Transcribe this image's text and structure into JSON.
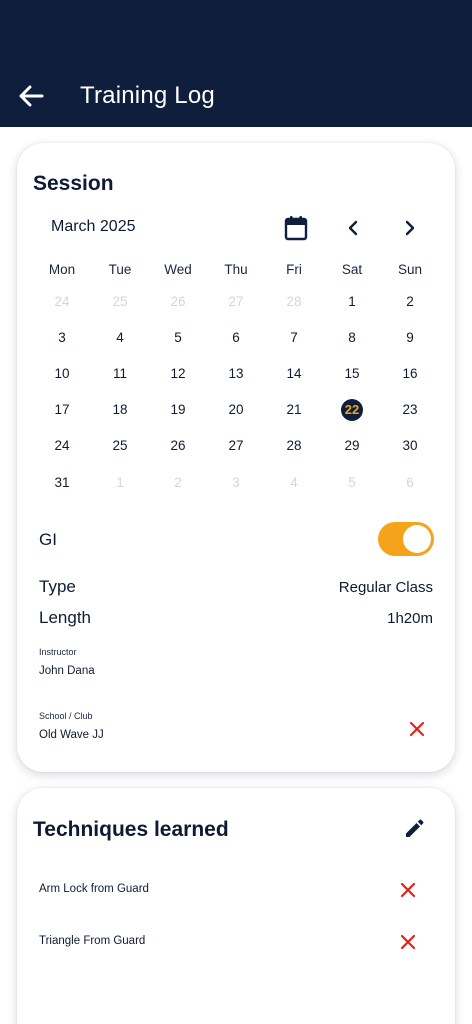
{
  "appbar": {
    "title": "Training Log"
  },
  "session": {
    "title": "Session",
    "calendar": {
      "month": "March 2025",
      "weekdays": [
        "Mon",
        "Tue",
        "Wed",
        "Thu",
        "Fri",
        "Sat",
        "Sun"
      ],
      "days": [
        {
          "d": "24",
          "muted": true
        },
        {
          "d": "25",
          "muted": true
        },
        {
          "d": "26",
          "muted": true
        },
        {
          "d": "27",
          "muted": true
        },
        {
          "d": "28",
          "muted": true
        },
        {
          "d": "1"
        },
        {
          "d": "2"
        },
        {
          "d": "3"
        },
        {
          "d": "4"
        },
        {
          "d": "5"
        },
        {
          "d": "6"
        },
        {
          "d": "7"
        },
        {
          "d": "8"
        },
        {
          "d": "9"
        },
        {
          "d": "10"
        },
        {
          "d": "11"
        },
        {
          "d": "12"
        },
        {
          "d": "13"
        },
        {
          "d": "14"
        },
        {
          "d": "15"
        },
        {
          "d": "16"
        },
        {
          "d": "17"
        },
        {
          "d": "18"
        },
        {
          "d": "19"
        },
        {
          "d": "20"
        },
        {
          "d": "21"
        },
        {
          "d": "22",
          "selected": true
        },
        {
          "d": "23"
        },
        {
          "d": "24"
        },
        {
          "d": "25"
        },
        {
          "d": "26"
        },
        {
          "d": "27"
        },
        {
          "d": "28"
        },
        {
          "d": "29"
        },
        {
          "d": "30"
        },
        {
          "d": "31"
        },
        {
          "d": "1",
          "muted": true
        },
        {
          "d": "2",
          "muted": true
        },
        {
          "d": "3",
          "muted": true
        },
        {
          "d": "4",
          "muted": true
        },
        {
          "d": "5",
          "muted": true
        },
        {
          "d": "6",
          "muted": true
        }
      ]
    },
    "gi": {
      "label": "GI",
      "on": true
    },
    "type": {
      "label": "Type",
      "value": "Regular Class"
    },
    "length": {
      "label": "Length",
      "value": "1h20m"
    },
    "instructor": {
      "label": "Instructor",
      "value": "John Dana"
    },
    "school": {
      "label": "School / Club",
      "value": "Old Wave JJ"
    }
  },
  "techniques": {
    "title": "Techniques learned",
    "items": [
      "Arm Lock from Guard",
      "Triangle From Guard"
    ]
  },
  "colors": {
    "navy": "#0f1e3d",
    "accent": "#f5a31a",
    "danger": "#e0241b"
  }
}
